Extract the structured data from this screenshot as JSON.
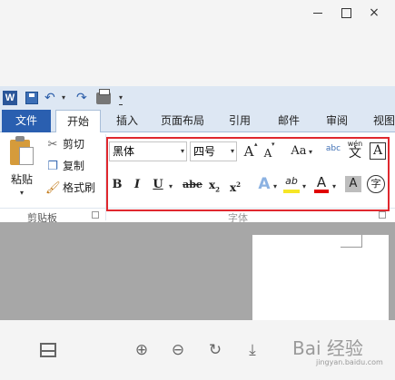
{
  "window": {
    "close_glyph": "×"
  },
  "qat": {
    "logo": "W",
    "undo": "↶",
    "redo": "↷",
    "dropdown": "▾"
  },
  "tabs": [
    {
      "label": "文件"
    },
    {
      "label": "开始"
    },
    {
      "label": "插入"
    },
    {
      "label": "页面布局"
    },
    {
      "label": "引用"
    },
    {
      "label": "邮件"
    },
    {
      "label": "审阅"
    },
    {
      "label": "视图"
    }
  ],
  "clipboard": {
    "paste_label": "粘贴",
    "cut_label": "剪切",
    "copy_label": "复制",
    "format_painter_label": "格式刷",
    "group_label": "剪贴板"
  },
  "font": {
    "font_name": "黑体",
    "font_size": "四号",
    "grow": "A",
    "shrink": "A",
    "change_case": "Aa",
    "phonetic_label": "wén",
    "phonetic_char": "文",
    "border_char": "A",
    "bold": "B",
    "italic": "I",
    "underline": "U",
    "strike": "abe",
    "subscript": "x",
    "superscript": "x",
    "text_effect": "A",
    "highlight": "ab",
    "font_color": "A",
    "shading": "A",
    "enclose": "字",
    "group_label": "字体"
  },
  "viewer": {
    "zoom_in": "⊕",
    "zoom_out": "⊖",
    "rotate": "↻",
    "download": "⤓"
  },
  "watermark": {
    "text": "Bai 经验",
    "sub": "jingyan.baidu.com"
  },
  "colors": {
    "file_tab": "#2a5fb0",
    "highlight_border": "#e0282e",
    "font_color_bar": "#e00000",
    "highlight_bar": "#f6e626"
  }
}
